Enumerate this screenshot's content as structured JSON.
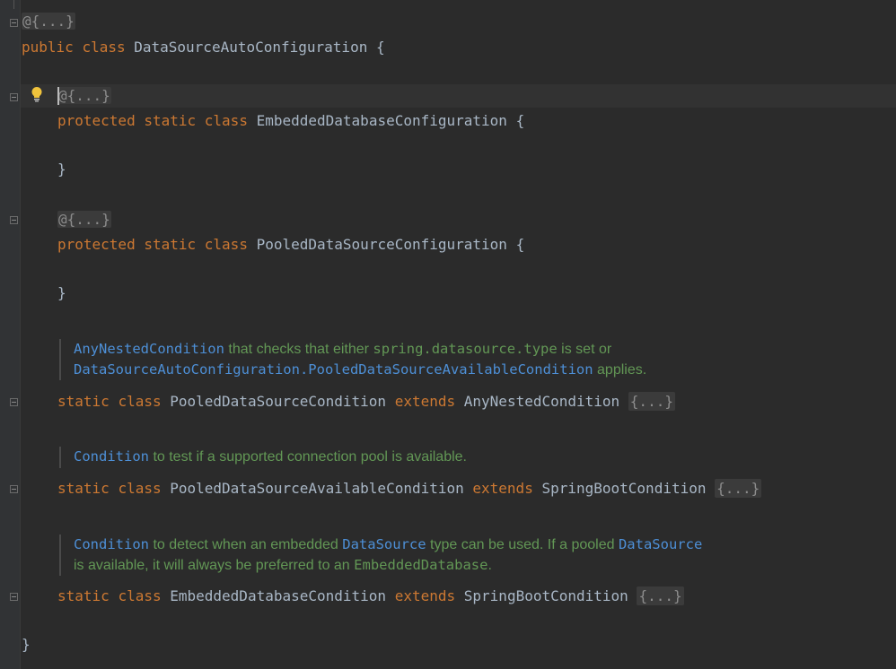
{
  "editor": {
    "lines": [
      {
        "tokens": [
          {
            "text": "@{...}",
            "kind": "fold"
          }
        ]
      },
      {
        "tokens": [
          {
            "text": "public",
            "kind": "kw"
          },
          {
            "text": " "
          },
          {
            "text": "class",
            "kind": "kw"
          },
          {
            "text": " DataSourceAutoConfiguration {"
          }
        ]
      },
      {
        "tokens": [
          {
            "text": "@{...}",
            "kind": "fold"
          }
        ]
      },
      {
        "tokens": [
          {
            "text": "protected",
            "kind": "kw"
          },
          {
            "text": " "
          },
          {
            "text": "static",
            "kind": "kw"
          },
          {
            "text": " "
          },
          {
            "text": "class",
            "kind": "kw"
          },
          {
            "text": " EmbeddedDatabaseConfiguration {"
          }
        ]
      },
      {
        "tokens": [
          {
            "text": "}"
          }
        ]
      },
      {
        "tokens": [
          {
            "text": "@{...}",
            "kind": "fold"
          }
        ]
      },
      {
        "tokens": [
          {
            "text": "protected",
            "kind": "kw"
          },
          {
            "text": " "
          },
          {
            "text": "static",
            "kind": "kw"
          },
          {
            "text": " "
          },
          {
            "text": "class",
            "kind": "kw"
          },
          {
            "text": " PooledDataSourceConfiguration {"
          }
        ]
      },
      {
        "tokens": [
          {
            "text": "}"
          }
        ]
      },
      {
        "tokens": [
          {
            "text": "static",
            "kind": "kw"
          },
          {
            "text": " "
          },
          {
            "text": "class",
            "kind": "kw"
          },
          {
            "text": " PooledDataSourceCondition "
          },
          {
            "text": "extends",
            "kind": "kw"
          },
          {
            "text": " AnyNestedCondition "
          },
          {
            "text": "{...}",
            "kind": "foldbody"
          }
        ]
      },
      {
        "tokens": [
          {
            "text": "static",
            "kind": "kw"
          },
          {
            "text": " "
          },
          {
            "text": "class",
            "kind": "kw"
          },
          {
            "text": " PooledDataSourceAvailableCondition "
          },
          {
            "text": "extends",
            "kind": "kw"
          },
          {
            "text": " SpringBootCondition "
          },
          {
            "text": "{...}",
            "kind": "foldbody"
          }
        ]
      },
      {
        "tokens": [
          {
            "text": "static",
            "kind": "kw"
          },
          {
            "text": " "
          },
          {
            "text": "class",
            "kind": "kw"
          },
          {
            "text": " EmbeddedDatabaseCondition "
          },
          {
            "text": "extends",
            "kind": "kw"
          },
          {
            "text": " SpringBootCondition "
          },
          {
            "text": "{...}",
            "kind": "foldbody"
          }
        ]
      },
      {
        "tokens": [
          {
            "text": "}"
          }
        ]
      }
    ],
    "docs": [
      {
        "lines": [
          [
            {
              "text": "AnyNestedCondition",
              "kind": "ref"
            },
            {
              "text": " that checks that either "
            },
            {
              "text": "spring.datasource.type",
              "kind": "code"
            },
            {
              "text": " is set or"
            }
          ],
          [
            {
              "text": "DataSourceAutoConfiguration.PooledDataSourceAvailableCondition",
              "kind": "ref"
            },
            {
              "text": " applies."
            }
          ]
        ]
      },
      {
        "lines": [
          [
            {
              "text": "Condition",
              "kind": "ref"
            },
            {
              "text": " to test if a supported connection pool is available."
            }
          ]
        ]
      },
      {
        "lines": [
          [
            {
              "text": "Condition",
              "kind": "ref"
            },
            {
              "text": " to detect when an embedded "
            },
            {
              "text": "DataSource",
              "kind": "ref"
            },
            {
              "text": " type can be used. If a pooled "
            },
            {
              "text": "DataSource",
              "kind": "ref"
            }
          ],
          [
            {
              "text": "is available, it will always be preferred to an "
            },
            {
              "text": "EmbeddedDatabase",
              "kind": "code"
            },
            {
              "text": "."
            }
          ]
        ]
      }
    ]
  },
  "colors": {
    "background": "#2b2b2b",
    "keyword": "#cc7832",
    "identifier": "#a9b7c6",
    "doc_text": "#629755",
    "doc_ref": "#4d8fd6",
    "fold": "#8c8c8c"
  },
  "icons": [
    "fold-marker-icon",
    "lightbulb-icon"
  ]
}
